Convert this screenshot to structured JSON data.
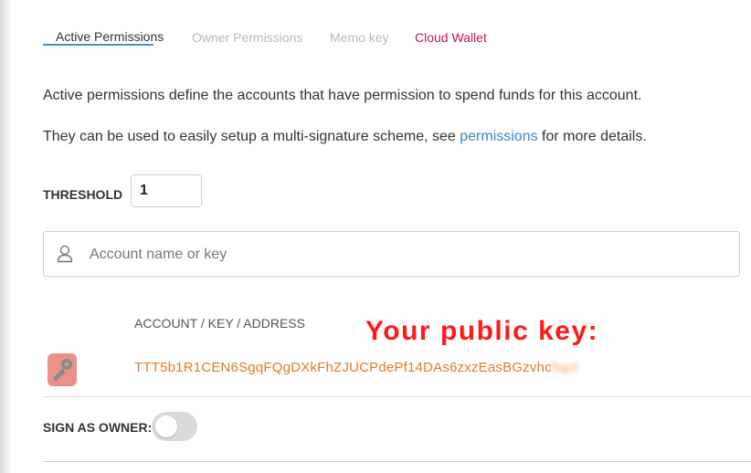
{
  "tabs": [
    {
      "label": "Active Permissions",
      "active": true
    },
    {
      "label": "Owner Permissions",
      "active": false
    },
    {
      "label": "Memo key",
      "active": false
    },
    {
      "label": "Cloud Wallet",
      "active": false
    }
  ],
  "description": {
    "line1": "Active permissions define the accounts that have permission to spend funds for this account.",
    "line2_prefix": "They can be used to easily setup a multi-signature scheme, see ",
    "line2_link": "permissions",
    "line2_suffix": " for more details."
  },
  "threshold": {
    "label": "THRESHOLD",
    "value": "1"
  },
  "search": {
    "placeholder": "Account name or key",
    "icon": "user-icon"
  },
  "table": {
    "column_header": "ACCOUNT / KEY / ADDRESS",
    "rows": [
      {
        "icon": "key-icon",
        "key_visible": "TTT5b1R1CEN6SgqFQgDXkFhZJUCPdePf14DAs6zxzEasBGzvhc",
        "key_blurred": "hqzt"
      }
    ]
  },
  "annotation": "Your public key:",
  "sign_as_owner": {
    "label": "SIGN AS OWNER:",
    "enabled": false
  },
  "colors": {
    "accent": "#4a90c9",
    "cloud_tab": "#c2185b",
    "key_text": "#e07b2a",
    "annotation": "#ff1a1a",
    "key_icon_bg": "#ec8f87"
  }
}
